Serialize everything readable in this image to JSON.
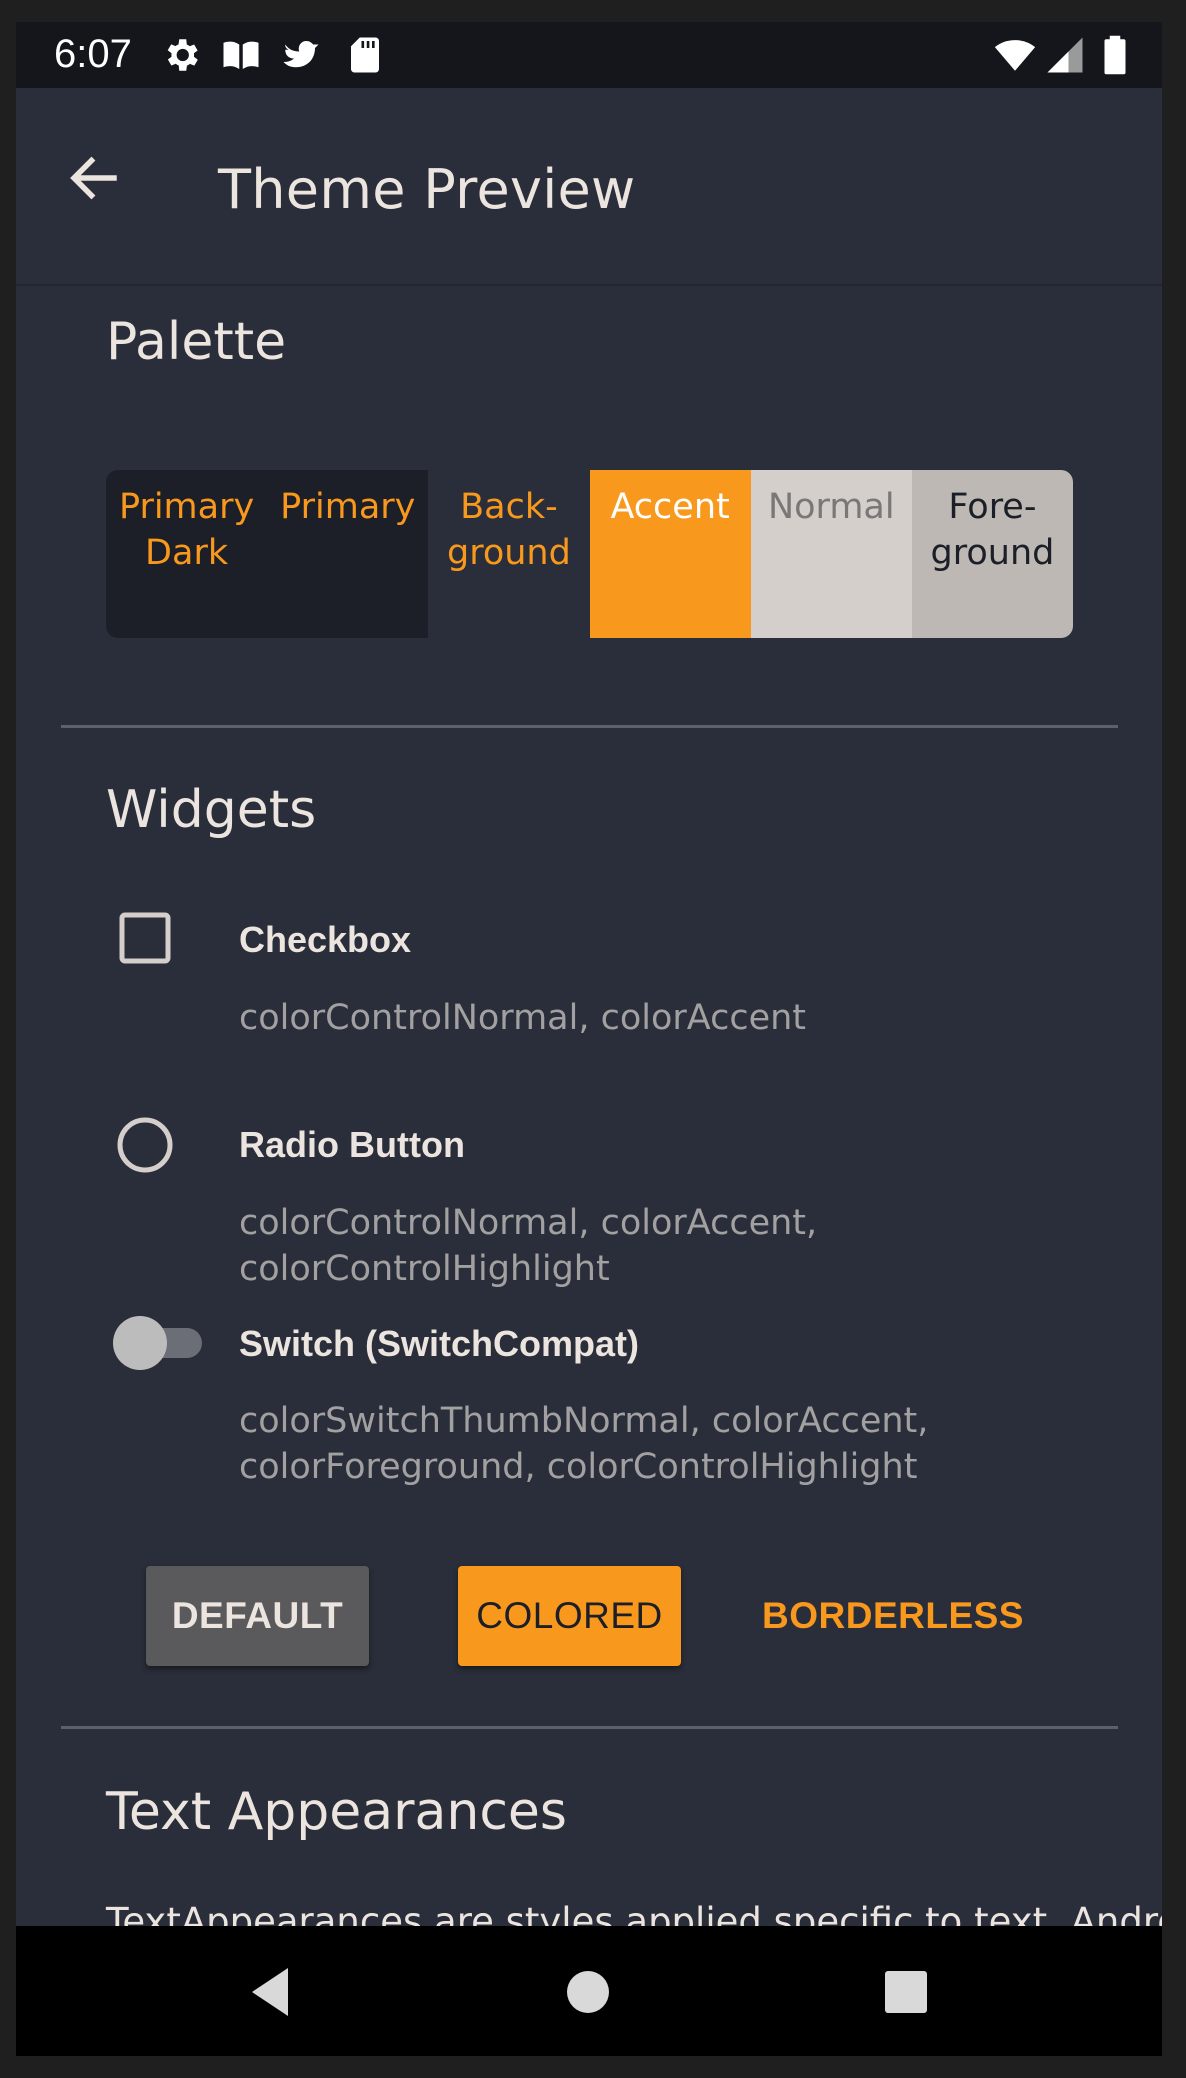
{
  "status_bar": {
    "time": "6:07",
    "icons": [
      "gear-icon",
      "book-icon",
      "bird-icon",
      "sd-card-icon",
      "wifi-icon",
      "signal-icon",
      "battery-icon"
    ]
  },
  "app_bar": {
    "title": "Theme Preview",
    "back_icon": "arrow-back-icon"
  },
  "palette": {
    "title": "Palette",
    "swatches": [
      {
        "label": "Primary\nDark",
        "bg": "#1c1f27",
        "fg": "#f8981d"
      },
      {
        "label": "Primary",
        "bg": "#1c1f27",
        "fg": "#f8981d"
      },
      {
        "label": "Back-\nground",
        "bg": "#2a2e3a",
        "fg": "#f8981d"
      },
      {
        "label": "Accent",
        "bg": "#f8981d",
        "fg": "#ffffff"
      },
      {
        "label": "Normal",
        "bg": "#d5cfcb",
        "fg": "#7a7777"
      },
      {
        "label": "Fore-\nground",
        "bg": "#bdb8b4",
        "fg": "#1c1f27"
      }
    ]
  },
  "widgets": {
    "title": "Widgets",
    "checkbox": {
      "label": "Checkbox",
      "desc": "colorControlNormal, colorAccent",
      "checked": false
    },
    "radio": {
      "label": "Radio Button",
      "desc": "colorControlNormal, colorAccent, colorControlHighlight",
      "selected": false
    },
    "switch": {
      "label": "Switch (SwitchCompat)",
      "desc": "colorSwitchThumbNormal, colorAccent,\ncolorForeground, colorControlHighlight",
      "on": false
    }
  },
  "buttons": {
    "default_label": "DEFAULT",
    "colored_label": "COLORED",
    "borderless_label": "BORDERLESS"
  },
  "text_appearances": {
    "title": "Text Appearances",
    "body_peek": "TextAppearances are styles applied specific to text. Android"
  },
  "nav_bar": {
    "icons": [
      "back-triangle-icon",
      "home-circle-icon",
      "recents-square-icon"
    ]
  },
  "colors": {
    "accent": "#f8981d",
    "background": "#2a2e3a",
    "primary_dark": "#1c1f27",
    "foreground": "#ece4de"
  }
}
